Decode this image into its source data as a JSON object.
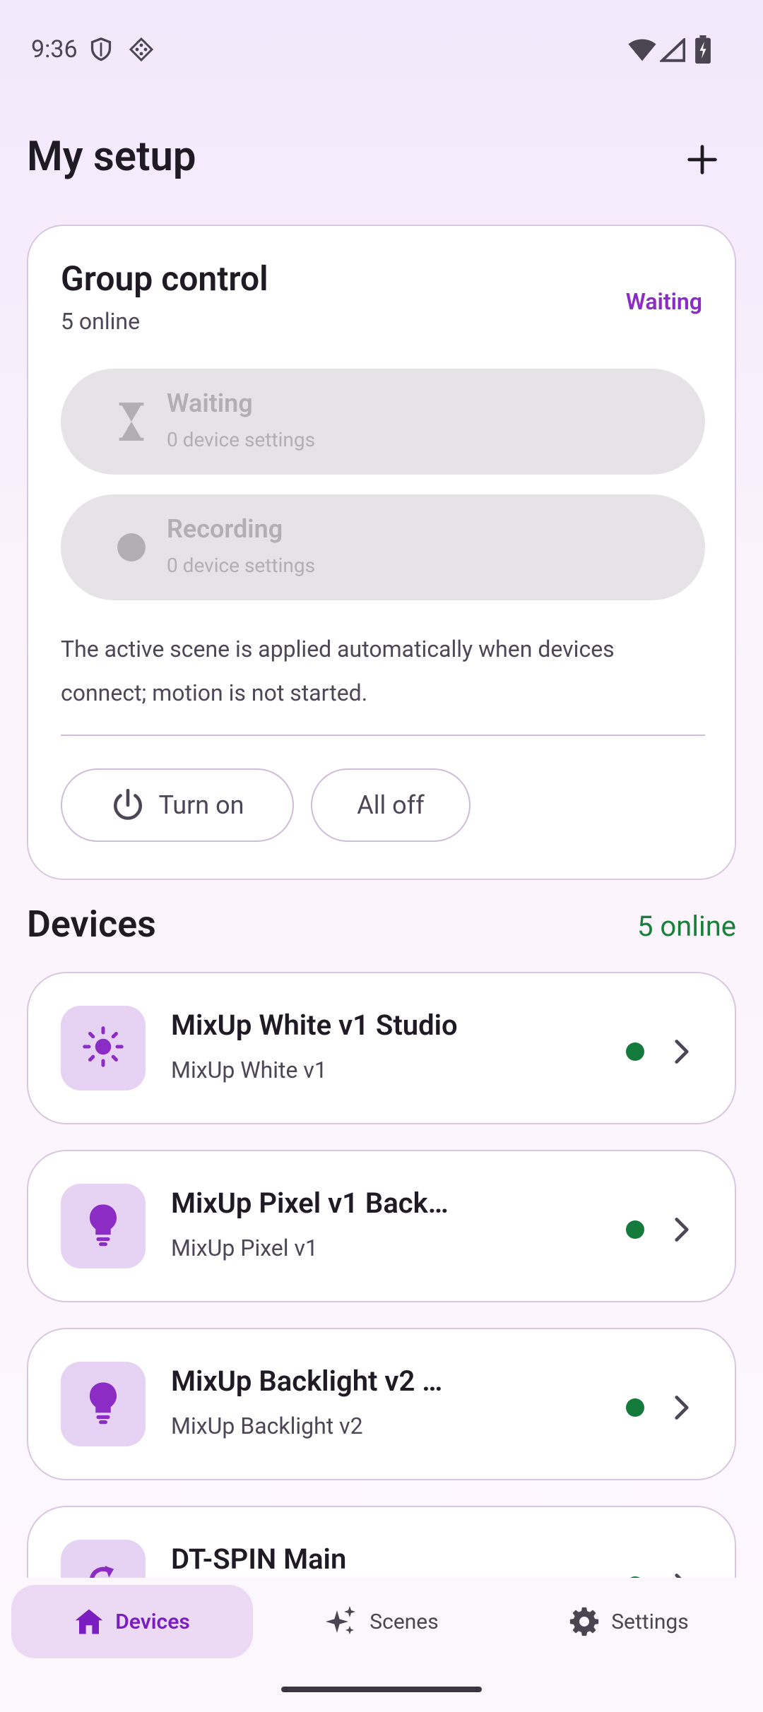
{
  "status_bar": {
    "time": "9:36"
  },
  "header": {
    "title": "My setup",
    "add_icon": "plus-icon"
  },
  "group_control": {
    "title": "Group control",
    "subtitle": "5 online",
    "status": "Waiting",
    "pills": [
      {
        "label": "Waiting",
        "sub": "0 device settings",
        "icon": "hourglass-icon"
      },
      {
        "label": "Recording",
        "sub": "0 device settings",
        "icon": "record-dot-icon"
      }
    ],
    "description": "The active scene is applied automatically when devices connect; motion is not started.",
    "turn_on_label": "Turn on",
    "all_off_label": "All off"
  },
  "devices": {
    "title": "Devices",
    "online": "5 online",
    "items": [
      {
        "name": "MixUp White v1 Studio",
        "model": "MixUp White v1",
        "icon": "sun-icon"
      },
      {
        "name": "MixUp Pixel v1 Back…",
        "model": "MixUp Pixel v1",
        "icon": "lightbulb-icon"
      },
      {
        "name": "MixUp Backlight v2 …",
        "model": "MixUp Backlight v2",
        "icon": "lightbulb-icon"
      },
      {
        "name": "DT-SPIN Main",
        "model": "",
        "icon": "rotate-icon"
      }
    ]
  },
  "colors": {
    "accent": "#8b2cc4",
    "online": "#147a3c",
    "pill_bg": "#e6e3e7",
    "icon_bg": "#e6d3f4"
  },
  "nav": {
    "items": [
      {
        "label": "Devices",
        "icon": "home-icon",
        "active": true
      },
      {
        "label": "Scenes",
        "icon": "sparkle-icon",
        "active": false
      },
      {
        "label": "Settings",
        "icon": "gear-icon",
        "active": false
      }
    ]
  }
}
